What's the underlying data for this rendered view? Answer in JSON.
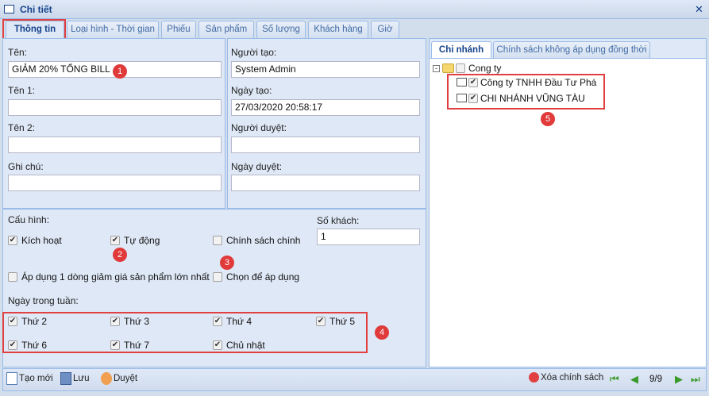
{
  "window": {
    "title": "Chi tiết"
  },
  "tabs": [
    "Thông tin",
    "Loại hình - Thời gian",
    "Phiếu",
    "Sản phẩm",
    "Số lượng",
    "Khách hàng",
    "Giờ"
  ],
  "form": {
    "ten": {
      "label": "Tên:",
      "value": "GIẢM 20% TỔNG BILL"
    },
    "ten1": {
      "label": "Tên 1:",
      "value": ""
    },
    "ten2": {
      "label": "Tên 2:",
      "value": ""
    },
    "ghichu": {
      "label": "Ghi chú:",
      "value": ""
    },
    "nguoitao": {
      "label": "Người tạo:",
      "value": "System Admin"
    },
    "ngaytao": {
      "label": "Ngày tạo:",
      "value": "27/03/2020 20:58:17"
    },
    "nguoiduyet": {
      "label": "Người duyệt:",
      "value": ""
    },
    "ngayduyet": {
      "label": "Ngày duyệt:",
      "value": ""
    }
  },
  "config": {
    "label": "Cấu hình:",
    "kich_hoat": {
      "label": "Kích hoạt",
      "checked": true
    },
    "tu_dong": {
      "label": "Tự động",
      "checked": true
    },
    "chinh_sach_chinh": {
      "label": "Chính sách chính",
      "checked": false
    },
    "ap_dung": {
      "label": "Áp dụng 1 dòng giảm giá sản phẩm lớn nhất",
      "checked": false
    },
    "chon_de_ap_dung": {
      "label": "Chọn để áp dụng",
      "checked": false
    },
    "so_khach": {
      "label": "Số khách:",
      "value": "1"
    }
  },
  "weekdays": {
    "label": "Ngày trong tuần:",
    "days": [
      {
        "label": "Thứ 2",
        "checked": true
      },
      {
        "label": "Thứ 3",
        "checked": true
      },
      {
        "label": "Thứ 4",
        "checked": true
      },
      {
        "label": "Thứ 5",
        "checked": true
      },
      {
        "label": "Thứ 6",
        "checked": true
      },
      {
        "label": "Thứ 7",
        "checked": true
      },
      {
        "label": "Chủ nhật",
        "checked": true
      }
    ]
  },
  "right": {
    "tabs": [
      "Chi nhánh",
      "Chính sách không áp dụng đồng thời"
    ],
    "tree": {
      "root": "Cong ty",
      "children": [
        "Công ty TNHH Đầu Tư Phá",
        "CHI NHÁNH VŨNG TÀU"
      ]
    }
  },
  "badges": [
    "1",
    "2",
    "3",
    "4",
    "5"
  ],
  "toolbar": {
    "new": "Tạo mới",
    "save": "Lưu",
    "approve": "Duyệt",
    "delete": "Xóa chính sách",
    "page": "9/9"
  }
}
